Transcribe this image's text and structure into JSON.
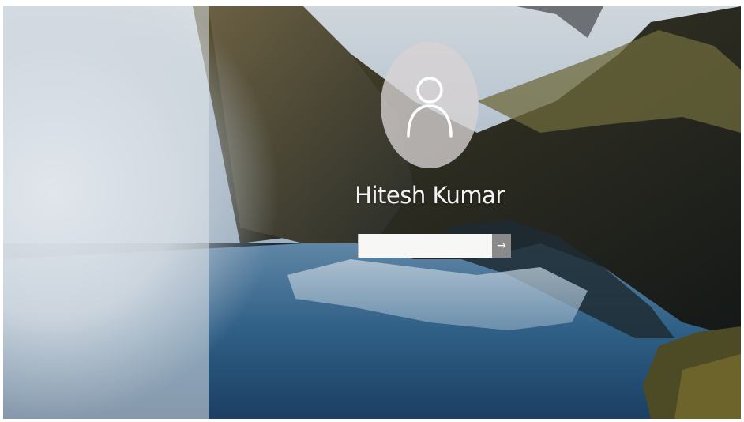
{
  "login": {
    "username": "Hitesh Kumar",
    "password_value": "",
    "submit_glyph": "→"
  },
  "icons": {
    "avatar": "user-silhouette-icon",
    "submit": "arrow-right-icon"
  },
  "colors": {
    "avatar_circle": "#d7d2d2",
    "input_background": "#f7f7f5",
    "submit_button": "#8a8a8a",
    "username_text": "#f4f3f2"
  }
}
